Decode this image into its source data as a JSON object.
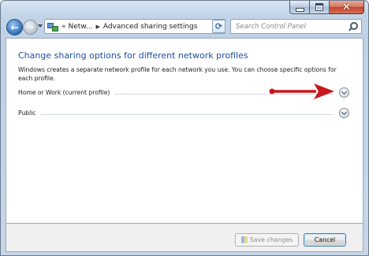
{
  "window": {
    "caption_buttons": [
      "minimize",
      "maximize",
      "close"
    ]
  },
  "nav": {
    "breadcrumb_root": "Netw...",
    "breadcrumb_current": "Advanced sharing settings",
    "search_placeholder": "Search Control Panel"
  },
  "content": {
    "title": "Change sharing options for different network profiles",
    "description": "Windows creates a separate network profile for each network you use. You can choose specific options for each profile.",
    "profiles": [
      {
        "label": "Home or Work (current profile)"
      },
      {
        "label": "Public"
      }
    ]
  },
  "annotation": {
    "arrow_color": "#c8171b"
  },
  "footer": {
    "save_label": "Save changes",
    "cancel_label": "Cancel"
  },
  "colors": {
    "title": "#1e4e9a",
    "frame": "#c3d4e7"
  }
}
